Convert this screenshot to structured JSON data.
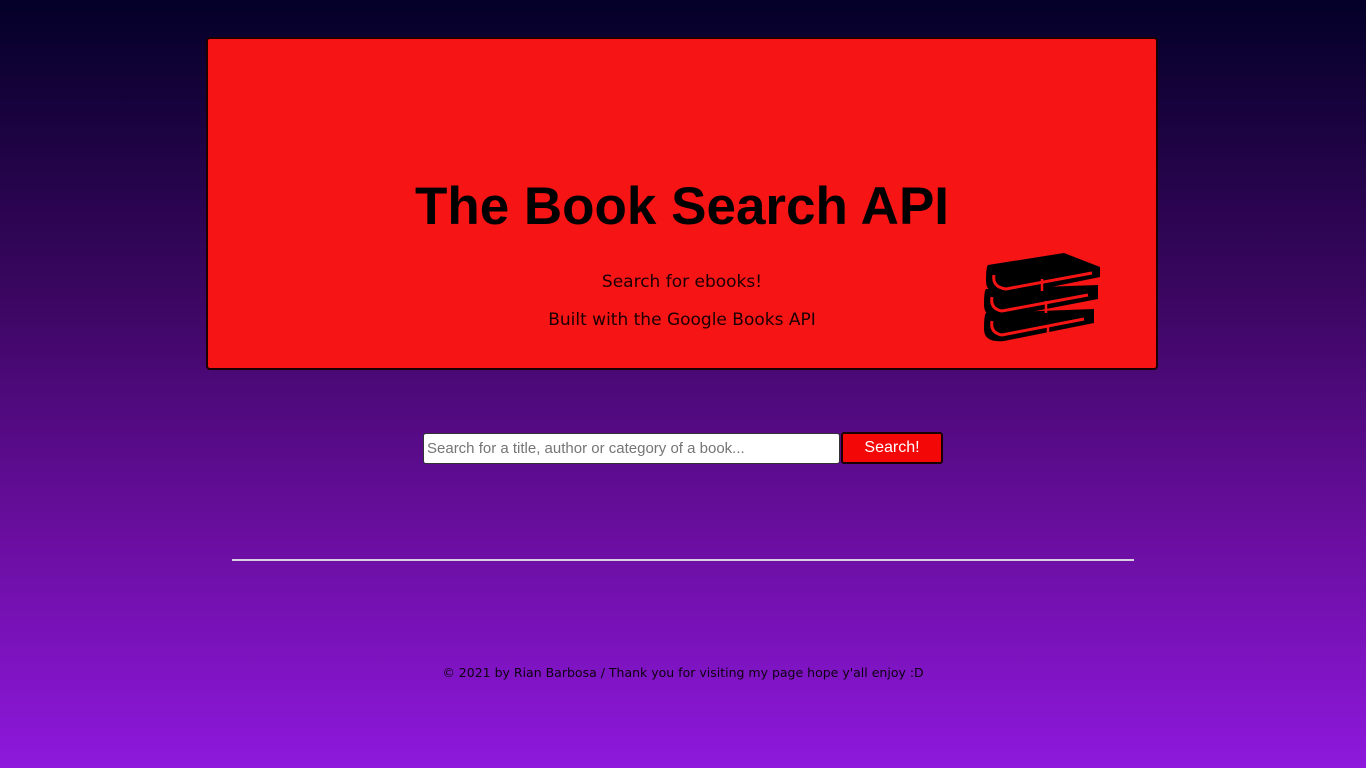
{
  "hero": {
    "title": "The Book Search API",
    "subtitle_1": "Search for ebooks!",
    "subtitle_2": "Built with the Google Books API",
    "icon": "books-stack-icon",
    "background_color": "#f71414"
  },
  "search": {
    "value": "",
    "placeholder": "Search for a title, author or category of a book...",
    "button_label": "Search!"
  },
  "footer": {
    "text": "© 2021 by Rian Barbosa / Thank you for visiting my page hope y'all enjoy :D"
  },
  "colors": {
    "background_top": "#030028",
    "background_bottom": "#8e18dc",
    "accent": "#f40707"
  }
}
